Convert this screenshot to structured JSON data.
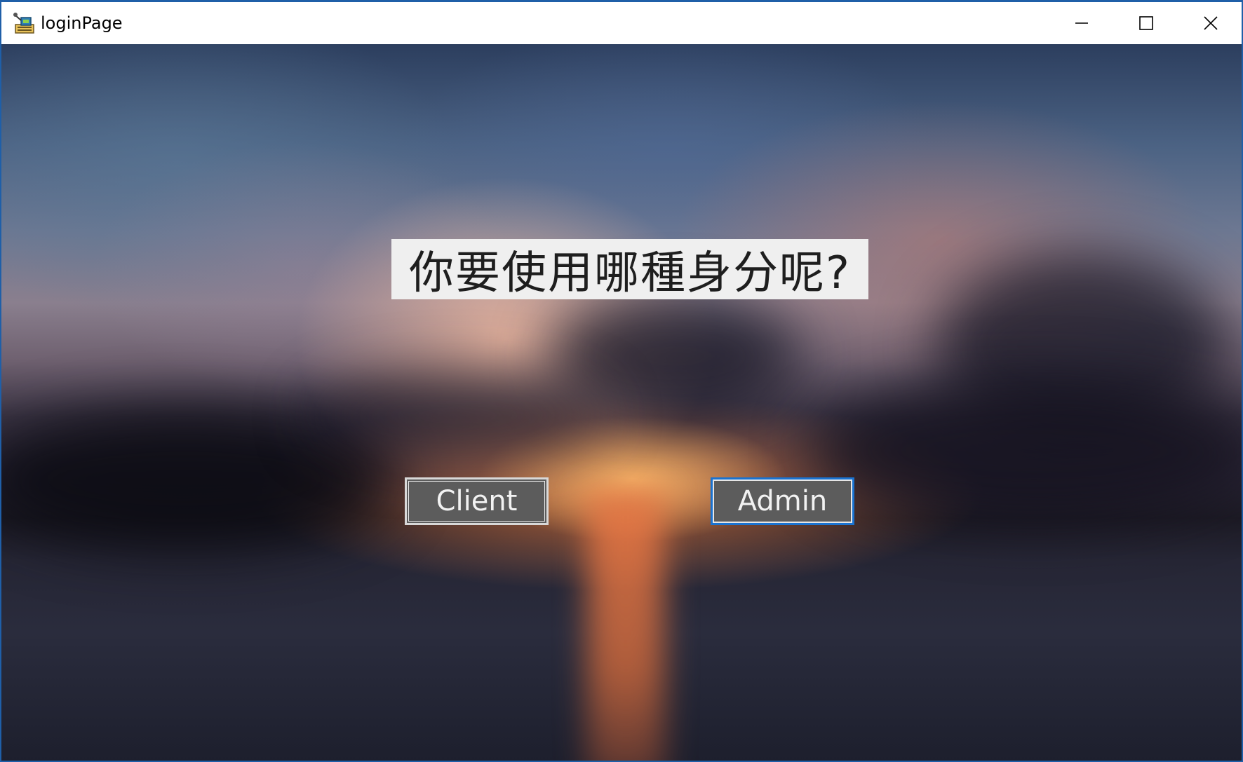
{
  "window": {
    "title": "loginPage",
    "accent_color": "#1f5fa8",
    "controls": {
      "minimize_icon": "minimize-icon",
      "maximize_icon": "maximize-icon",
      "close_icon": "close-icon"
    }
  },
  "main": {
    "question": "你要使用哪種身分呢?",
    "buttons": {
      "client_label": "Client",
      "admin_label": "Admin"
    },
    "focused_button": "Admin",
    "button_color": "#5c5c5c",
    "focus_color": "#1a73d1"
  }
}
